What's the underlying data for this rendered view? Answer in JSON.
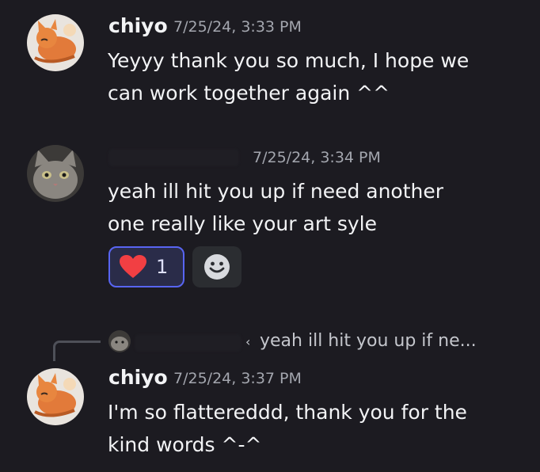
{
  "messages": [
    {
      "author": "chiyo",
      "timestamp": "7/25/24, 3:33 PM",
      "lines": [
        "Yeyyy thank you so much, I hope we",
        "can work together again ^^"
      ]
    },
    {
      "author": "",
      "timestamp": "7/25/24, 3:34 PM",
      "lines": [
        "yeah ill hit you up if need another",
        "one really like your art syle"
      ],
      "reaction": {
        "emoji": "heart-icon",
        "count": "1"
      }
    },
    {
      "author": "chiyo",
      "timestamp": "7/25/24, 3:37 PM",
      "reply_preview": "yeah ill hit you up if ne...",
      "lines": [
        "I'm so flattereddd, thank you for the",
        "kind words ^-^"
      ]
    }
  ],
  "colors": {
    "background": "#1c1b21",
    "text": "#f2f3f5",
    "timestamp": "#a3a6ae",
    "reaction_border": "#5865f2",
    "reaction_bg": "#2a2c49",
    "heart": "#f23f43"
  }
}
